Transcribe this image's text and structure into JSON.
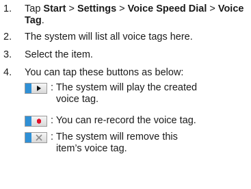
{
  "steps": [
    {
      "number": "1.",
      "text_parts": [
        "Tap ",
        "Start",
        ">",
        "Settings",
        ">",
        "Voice Speed Dial",
        ">",
        "Voice Tag",
        "."
      ]
    },
    {
      "number": "2.",
      "text": "The system will list all voice tags here."
    },
    {
      "number": "3.",
      "text": "Select the item."
    },
    {
      "number": "4.",
      "text": "You can tap these buttons as below:"
    }
  ],
  "buttons": [
    {
      "icon": "play-icon",
      "colon": ":",
      "line1": "The system will play the created",
      "line2": "voice tag."
    },
    {
      "icon": "record-icon",
      "colon": ":",
      "line1": "You can re-record the voice tag."
    },
    {
      "icon": "delete-icon",
      "colon": ":",
      "line1": "The system will remove this",
      "line2": "item’s voice tag."
    }
  ],
  "colors": {
    "text": "#1a1a1a",
    "icon_accent": "#2f90d6",
    "record_red": "#e0102a",
    "delete_gray": "#8a8a8a"
  }
}
